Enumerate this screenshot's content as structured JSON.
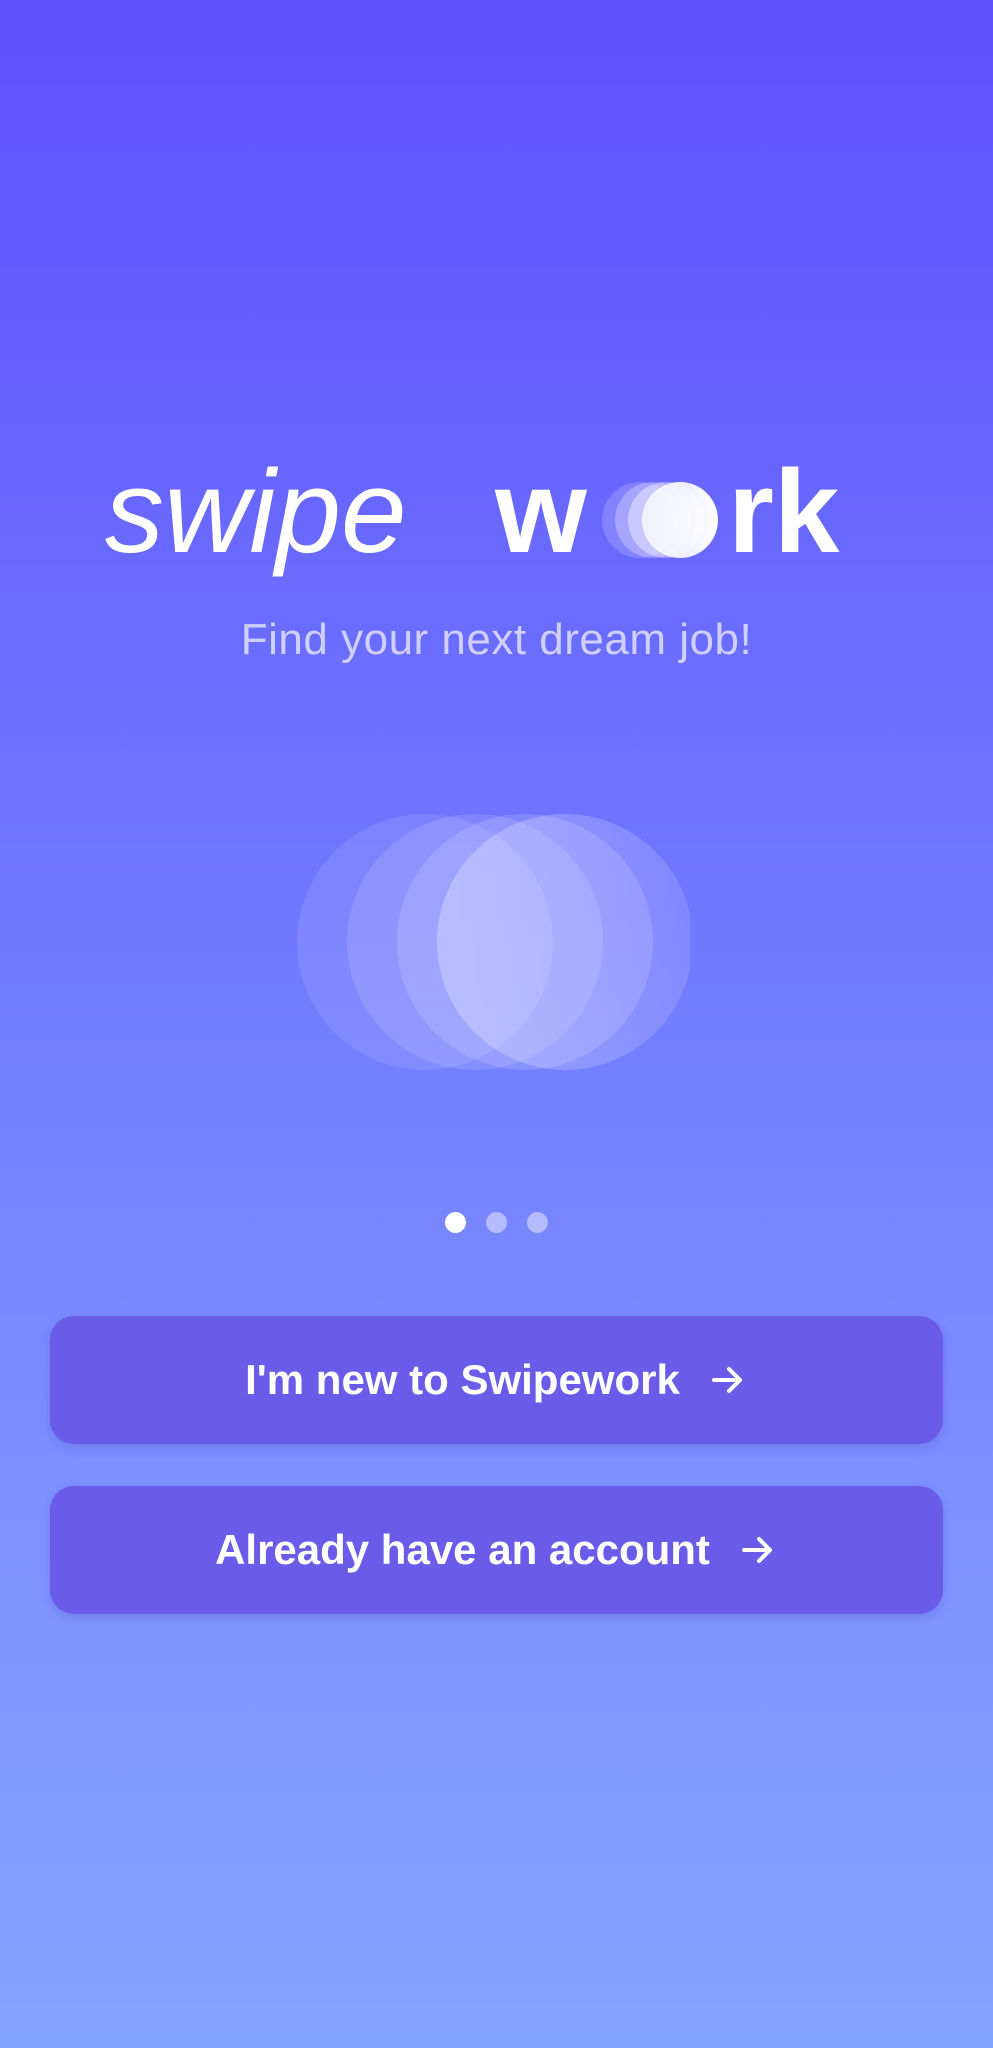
{
  "app": {
    "wordmark_part1": "swipe",
    "wordmark_part2": "w",
    "wordmark_part3": "rk",
    "brand_name": "swipework",
    "tagline": "Find your next dream job!"
  },
  "carousel": {
    "pages": 3,
    "active_index": 0
  },
  "actions": {
    "new_user_label": "I'm new to Swipework",
    "existing_user_label": "Already have an account",
    "arrow_icon": "arrow-right-icon"
  },
  "colors": {
    "background_top": "#5f51ff",
    "background_bottom": "#84a5ff",
    "button": "#6a5ce8",
    "text": "#ffffff",
    "tagline": "#cfd0ff"
  }
}
